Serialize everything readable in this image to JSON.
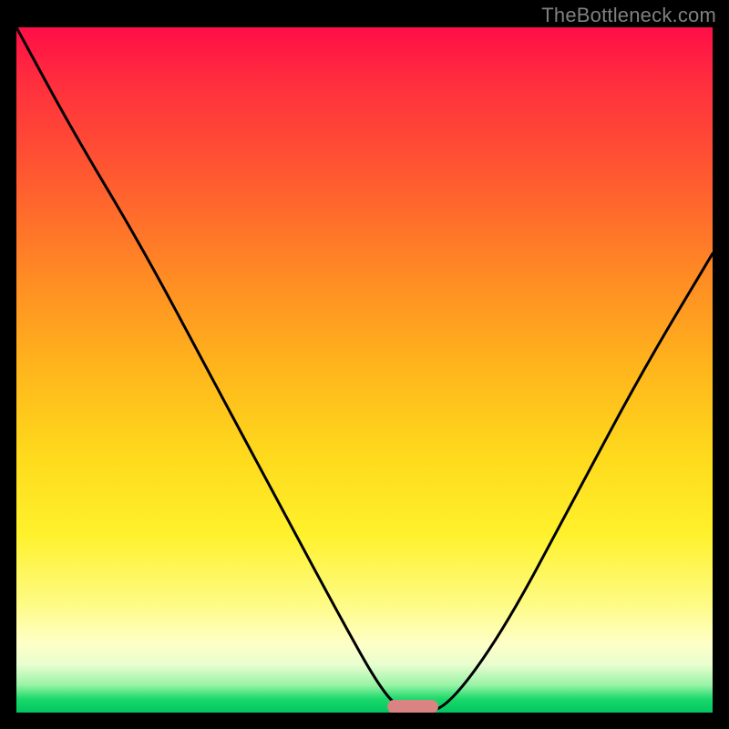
{
  "watermark": "TheBottleneck.com",
  "chart_data": {
    "type": "line",
    "title": "",
    "xlabel": "",
    "ylabel": "",
    "xlim": [
      0,
      100
    ],
    "ylim": [
      0,
      100
    ],
    "grid": false,
    "series": [
      {
        "name": "bottleneck-curve",
        "x": [
          0,
          8,
          18,
          28,
          38,
          47,
          52,
          55,
          58,
          62,
          70,
          80,
          90,
          100
        ],
        "values": [
          100,
          85,
          68,
          49,
          30,
          13,
          4,
          0.5,
          0,
          0.8,
          12,
          31,
          50,
          67
        ]
      }
    ],
    "annotations": [
      {
        "name": "optimal-marker",
        "x": 57,
        "y": 0
      }
    ],
    "background_gradient_stops": [
      {
        "pct": 0,
        "color": "#ff0e47"
      },
      {
        "pct": 50,
        "color": "#ffb61c"
      },
      {
        "pct": 100,
        "color": "#00c661"
      }
    ]
  }
}
